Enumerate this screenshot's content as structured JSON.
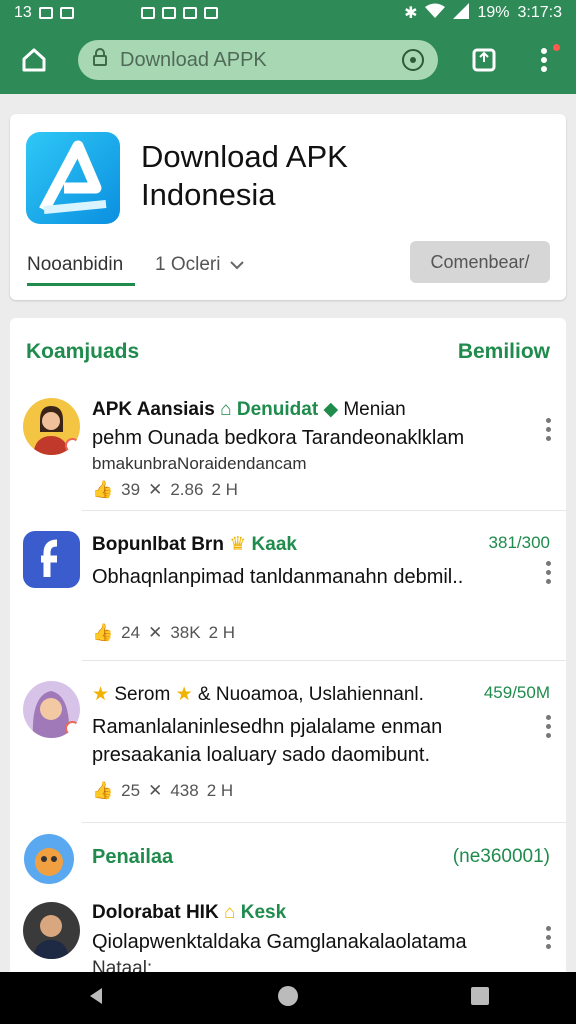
{
  "status": {
    "time": "13",
    "battery": "19%",
    "clock": "3:17:3"
  },
  "browser": {
    "url": "Download APPK"
  },
  "app": {
    "title_line1": "Download APK",
    "title_line2": "Indonesia",
    "tab_active": "Nooanbidin",
    "tab_second": "1 Ocleri",
    "action_button": "Comenbear/"
  },
  "feed": {
    "header_left": "Koamjuads",
    "header_right": "Bemiliow",
    "posts": [
      {
        "name": "APK Aansiais",
        "tag": "Denuidat",
        "extra": "Menian",
        "body": "pehm Ounada bedkora Tarandeonaklklam",
        "sub": "bmakunbraNoraidendancam",
        "likes": "39",
        "shares": "2.86",
        "time": "2 H"
      },
      {
        "name": "Bopunlbat Brn",
        "tag": "Kaak",
        "right": "381/300",
        "body": "Obhaqnlanpimad tanldanmanahn debmil..",
        "likes": "24",
        "shares": "38K",
        "time": "2 H"
      },
      {
        "name": "Serom",
        "tag": "& Nuoamoa, Uslahiennanl.",
        "right": "459/50M",
        "body": "Ramanlalaninlesedhn pjalalame enman presaakania loaluary sado daomibunt.",
        "likes": "25",
        "shares": "438",
        "time": "2 H"
      }
    ],
    "section_title": "Penailaa",
    "section_right": "(ne360001)",
    "last_post": {
      "name": "Dolorabat HIK",
      "tag": "Kesk",
      "body": "Qiolapwenktaldaka Gamglanakalaolatama",
      "sub": "Nataal:"
    }
  },
  "colors": {
    "brand": "#2e8b57",
    "accent": "#1f8b4c"
  }
}
